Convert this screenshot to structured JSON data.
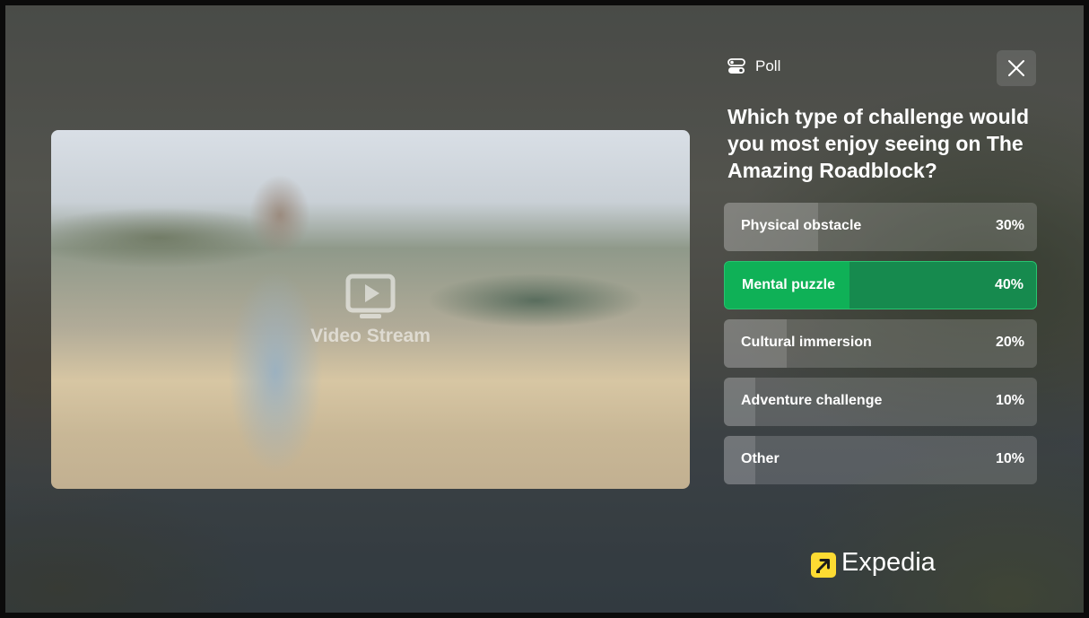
{
  "video": {
    "label": "Video Stream",
    "icon": "play-screen-icon"
  },
  "poll": {
    "title": "Poll",
    "icon": "toggle-poll-icon",
    "close_icon": "close-icon",
    "question": "Which type of challenge would you most enjoy seeing on The Amazing Roadblock?",
    "options": [
      {
        "label": "Physical obstacle",
        "percent_text": "30%",
        "percent": 30,
        "selected": false
      },
      {
        "label": "Mental puzzle",
        "percent_text": "40%",
        "percent": 40,
        "selected": true
      },
      {
        "label": "Cultural immersion",
        "percent_text": "20%",
        "percent": 20,
        "selected": false
      },
      {
        "label": "Adventure challenge",
        "percent_text": "10%",
        "percent": 10,
        "selected": false
      },
      {
        "label": "Other",
        "percent_text": "10%",
        "percent": 10,
        "selected": false
      }
    ],
    "selected_color": "#19a05a"
  },
  "brand": {
    "name": "Expedia",
    "icon": "expedia-arrow-icon",
    "icon_color": "#fddb32"
  }
}
